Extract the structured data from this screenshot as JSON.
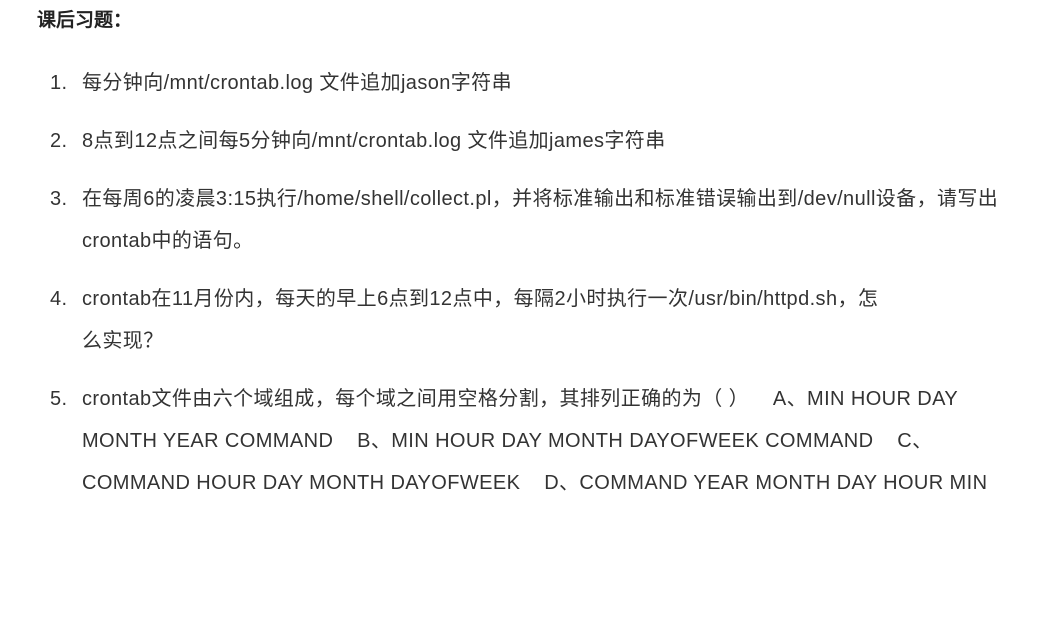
{
  "title": "课后习题：",
  "items": [
    {
      "num": "1.",
      "text": "每分钟向/mnt/crontab.log 文件追加jason字符串"
    },
    {
      "num": "2.",
      "text": "8点到12点之间每5分钟向/mnt/crontab.log 文件追加james字符串"
    },
    {
      "num": "3.",
      "text": "在每周6的凌晨3:15执行/home/shell/collect.pl，并将标准输出和标准错误输出到/dev/null设备，请写出crontab中的语句。"
    },
    {
      "num": "4.",
      "text": "crontab在11月份内，每天的早上6点到12点中，每隔2小时执行一次/usr/bin/httpd.sh，怎么实现？"
    },
    {
      "num": "5.",
      "text": "crontab文件由六个域组成，每个域之间用空格分割，其排列正确的为（ ）    A、MIN HOUR DAY MONTH YEAR COMMAND    B、MIN HOUR DAY MONTH DAYOFWEEK COMMAND    C、COMMAND HOUR DAY MONTH DAYOFWEEK    D、COMMAND YEAR MONTH DAY HOUR MIN"
    }
  ]
}
